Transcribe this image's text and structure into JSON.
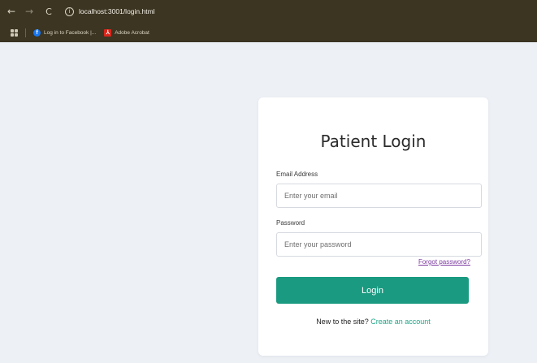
{
  "browser": {
    "nav_back": "←",
    "nav_forward": "→",
    "nav_reload": "C",
    "info": "i",
    "url": "localhost:3001/login.html",
    "bookmarks": [
      {
        "label": "Log in to Facebook |...",
        "icon": "facebook-icon",
        "color": "#1877f2"
      },
      {
        "label": "Adobe Acrobat",
        "icon": "adobe-acrobat-icon",
        "color": "#d9261c"
      }
    ]
  },
  "login": {
    "title": "Patient Login",
    "email_label": "Email Address",
    "email_placeholder": "Enter your email",
    "password_label": "Password",
    "password_placeholder": "Enter your password",
    "forgot_password": "Forgot password?",
    "login_button": "Login",
    "signup_prompt": "New to the site?",
    "signup_link": "Create an account"
  },
  "colors": {
    "accent": "#1a9a80",
    "link": "#20a486",
    "forgot_link": "#7b3aa0",
    "page_background": "#edf1f6"
  }
}
